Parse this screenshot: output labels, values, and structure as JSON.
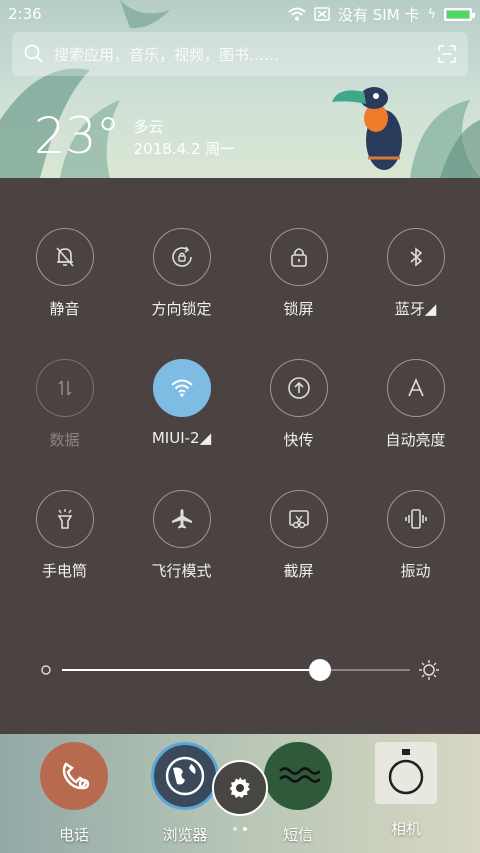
{
  "status_bar": {
    "time": "2:36",
    "carrier": "没有 SIM 卡"
  },
  "search": {
    "placeholder": "搜索应用，音乐，视频，图书……"
  },
  "weather": {
    "temperature": "23°",
    "condition": "多云",
    "date": "2018.4.2 周一"
  },
  "toggles": [
    {
      "label": "静音",
      "icon": "bell-off-icon",
      "state": "off"
    },
    {
      "label": "方向锁定",
      "icon": "rotation-lock-icon",
      "state": "off"
    },
    {
      "label": "锁屏",
      "icon": "lock-icon",
      "state": "off"
    },
    {
      "label": "蓝牙◢",
      "icon": "bluetooth-icon",
      "state": "off"
    },
    {
      "label": "数据",
      "icon": "data-arrows-icon",
      "state": "disabled"
    },
    {
      "label": "MIUI-2◢",
      "icon": "wifi-icon",
      "state": "on"
    },
    {
      "label": "快传",
      "icon": "share-icon",
      "state": "off"
    },
    {
      "label": "自动亮度",
      "icon": "auto-brightness-icon",
      "state": "off"
    },
    {
      "label": "手电筒",
      "icon": "flashlight-icon",
      "state": "off"
    },
    {
      "label": "飞行模式",
      "icon": "airplane-icon",
      "state": "off"
    },
    {
      "label": "截屏",
      "icon": "screenshot-icon",
      "state": "off"
    },
    {
      "label": "振动",
      "icon": "vibrate-icon",
      "state": "off"
    }
  ],
  "brightness": {
    "value": 0.74
  },
  "dock": [
    {
      "label": "电话",
      "icon": "phone-icon",
      "color": "#b86a4e"
    },
    {
      "label": "浏览器",
      "icon": "globe-icon",
      "color": "#3a4a5a"
    },
    {
      "label": "短信",
      "icon": "message-icon",
      "color": "#2f5a3a"
    },
    {
      "label": "相机",
      "icon": "camera-icon",
      "color": "#e8e8e0"
    }
  ],
  "colors": {
    "accent": "#7fbce4",
    "panel": "#4a4341",
    "battery": "#4cd964"
  }
}
